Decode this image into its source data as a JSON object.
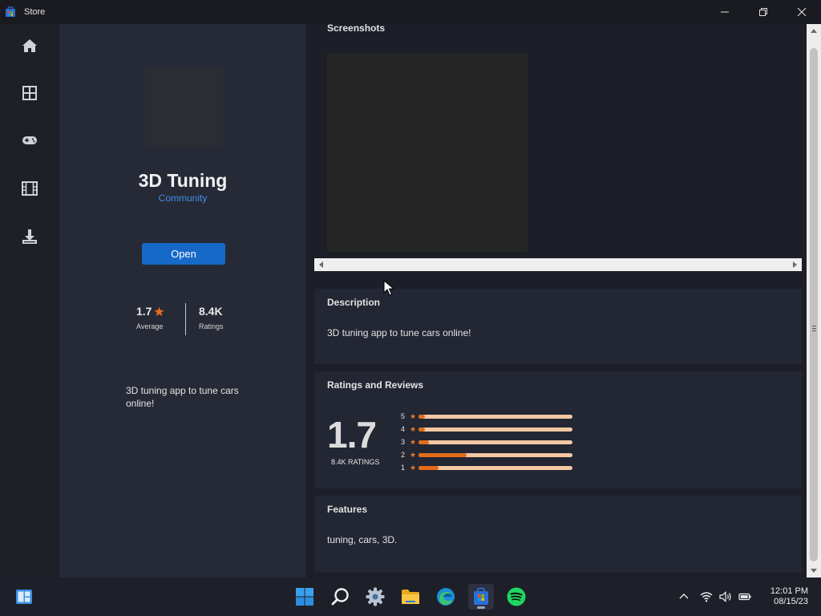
{
  "window": {
    "title": "Store"
  },
  "nav": {
    "items": [
      {
        "icon": "home-icon",
        "label": "Home"
      },
      {
        "icon": "apps-icon",
        "label": "Apps"
      },
      {
        "icon": "gamepad-icon",
        "label": "Gaming"
      },
      {
        "icon": "film-icon",
        "label": "Movies"
      },
      {
        "icon": "download-icon",
        "label": "Downloads"
      }
    ]
  },
  "app": {
    "name": "3D Tuning",
    "publisher": "Community",
    "open_label": "Open",
    "average_value": "1.7",
    "average_label": "Average",
    "ratings_value": "8.4K",
    "ratings_label": "Ratings",
    "short_description": "3D tuning app to tune cars online!"
  },
  "screenshots": {
    "title": "Screenshots"
  },
  "description": {
    "title": "Description",
    "text": "3D tuning app to tune cars online!"
  },
  "ratings": {
    "title": "Ratings and Reviews",
    "score": "1.7",
    "count_label": "8.4K RATINGS",
    "bars": [
      {
        "stars": "5",
        "fraction": 0.04
      },
      {
        "stars": "4",
        "fraction": 0.04
      },
      {
        "stars": "3",
        "fraction": 0.07
      },
      {
        "stars": "2",
        "fraction": 0.31
      },
      {
        "stars": "1",
        "fraction": 0.13
      }
    ]
  },
  "features": {
    "title": "Features",
    "text": "tuning, cars, 3D."
  },
  "taskbar": {
    "time": "12:01 PM",
    "date": "08/15/23"
  },
  "colors": {
    "accent": "#1769c8",
    "publisher_link": "#3e8ee6",
    "rating_orange": "#e36b1c",
    "rating_track": "#f3c8a2"
  }
}
